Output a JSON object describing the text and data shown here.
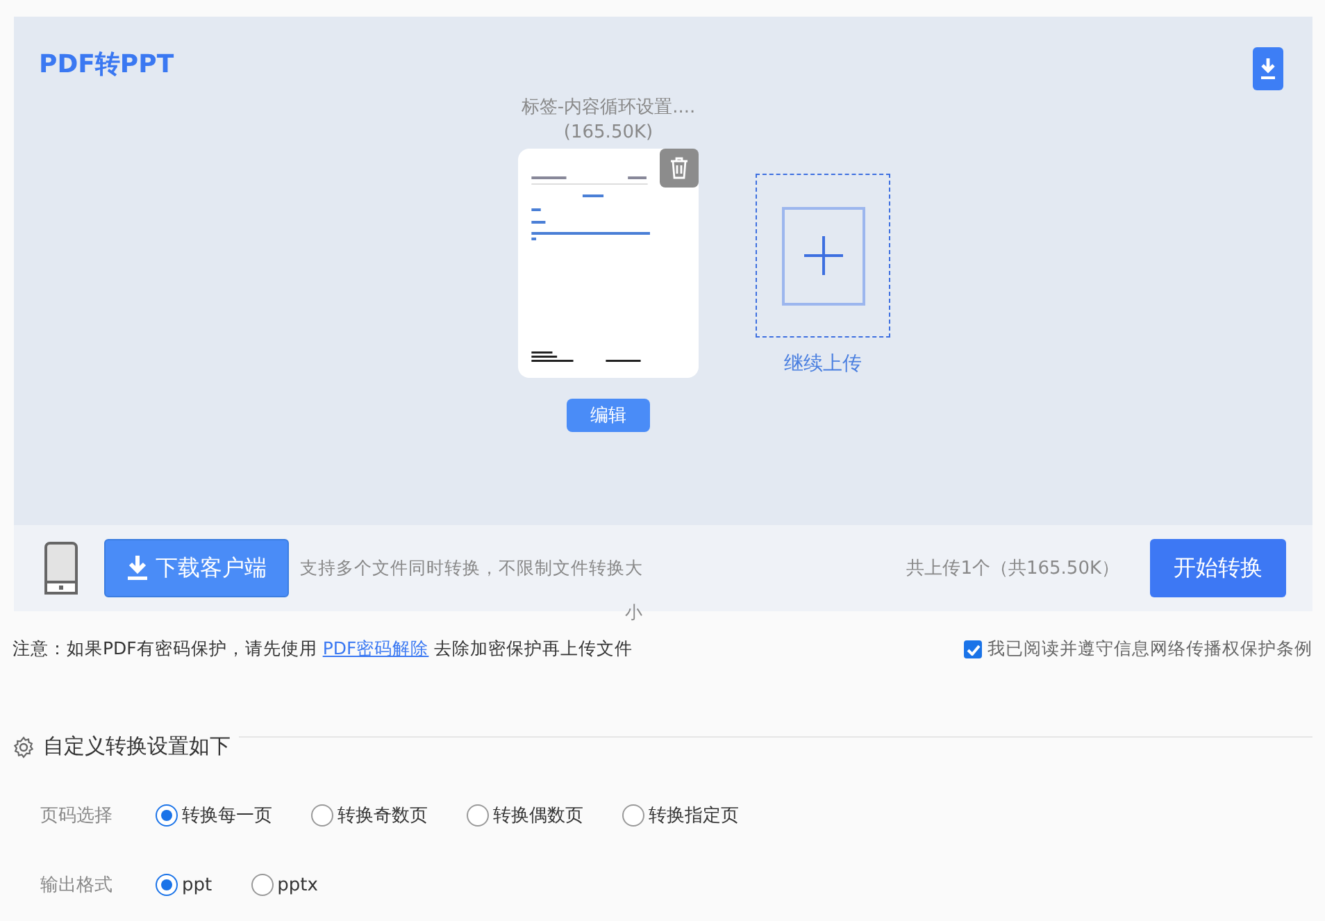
{
  "title": "PDF转PPT",
  "file": {
    "name": "标签-内容循环设置....",
    "size": "(165.50K)",
    "edit_button": "编辑"
  },
  "upload_more": "继续上传",
  "download_button": "下载客户端",
  "support_text": "支持多个文件同时转换，不限制文件转换大小",
  "summary": "共上传1个（共165.50K）",
  "start_button": "开始转换",
  "notice": {
    "before": "注意：如果PDF有密码保护，请先使用",
    "link": "PDF密码解除",
    "after": "去除加密保护再上传文件"
  },
  "agreement": {
    "label": "我已阅读并遵守信息网络传播权保护条例",
    "checked": true
  },
  "settings": {
    "title": "自定义转换设置如下",
    "groups": [
      {
        "label": "页码选择",
        "options": [
          {
            "label": "转换每一页",
            "selected": true
          },
          {
            "label": "转换奇数页",
            "selected": false
          },
          {
            "label": "转换偶数页",
            "selected": false
          },
          {
            "label": "转换指定页",
            "selected": false
          }
        ]
      },
      {
        "label": "输出格式",
        "options": [
          {
            "label": "ppt",
            "selected": true
          },
          {
            "label": "pptx",
            "selected": false
          }
        ]
      }
    ]
  }
}
